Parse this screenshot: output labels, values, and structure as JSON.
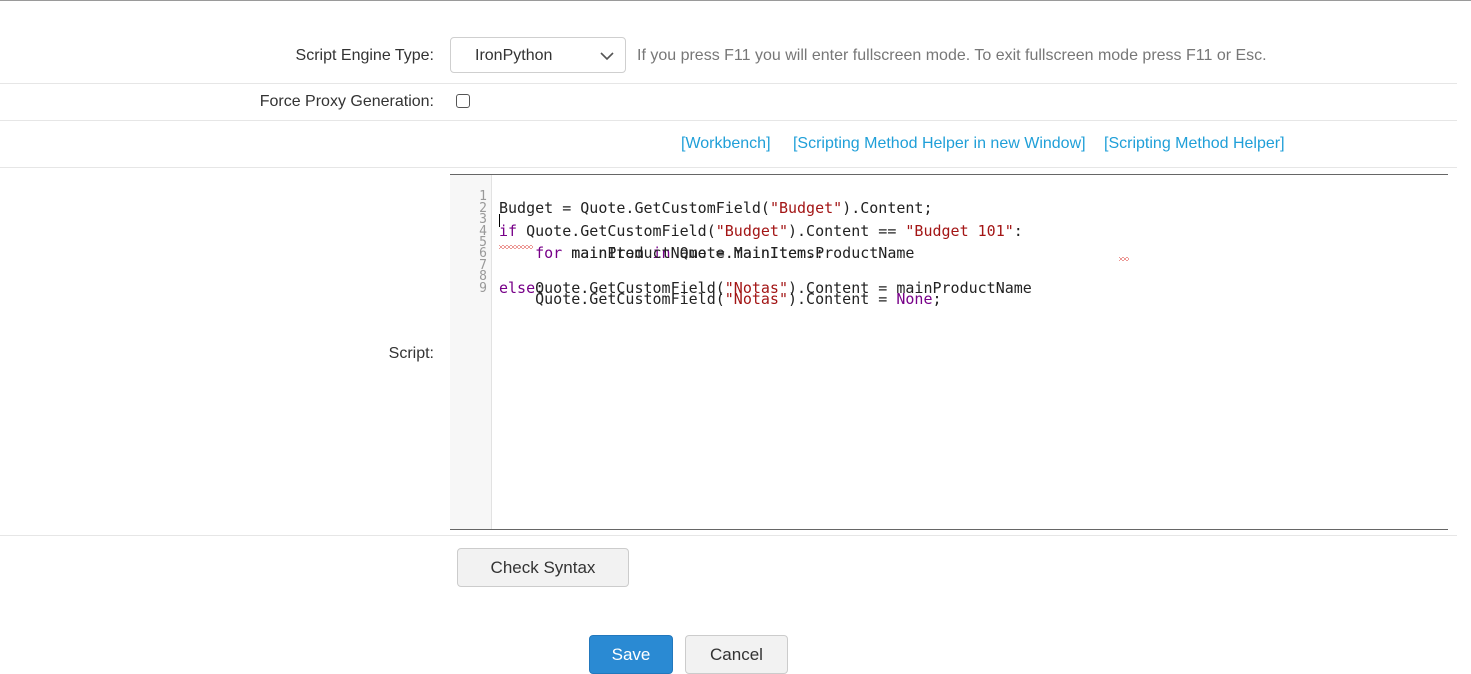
{
  "form": {
    "engine_label": "Script Engine Type:",
    "engine_value": "IronPython",
    "engine_hint": "If you press F11 you will enter fullscreen mode. To exit fullscreen mode press F11 or Esc.",
    "proxy_label": "Force Proxy Generation:",
    "proxy_checked": false,
    "script_label": "Script:"
  },
  "links": [
    "[Workbench]",
    "[Scripting Method Helper in new Window]",
    "[Scripting Method Helper]"
  ],
  "editor": {
    "line_numbers": [
      "1",
      "2",
      "3",
      "4",
      "5",
      "6",
      "7",
      "8",
      "9"
    ],
    "lines": [
      "Budget = Quote.GetCustomField(\"Budget\").Content;",
      "",
      "if Quote.GetCustomField(\"Budget\").Content == \"Budget 101\":",
      "    for mainItem in Quote.MainItems:",
      "        mainProductName = mainItem.ProductName",
      "",
      "    Quote.GetCustomField(\"Notas\").Content = mainProductName",
      "else:",
      "    Quote.GetCustomField(\"Notas\").Content = None;"
    ]
  },
  "buttons": {
    "check_syntax": "Check Syntax",
    "save": "Save",
    "cancel": "Cancel"
  },
  "colors": {
    "link": "#1f9fd8",
    "primary": "#2a8ad3",
    "string": "#a31515",
    "keyword": "#770088",
    "error": "#d9312b"
  },
  "icons": {
    "select_chevron": "chevron-down-icon"
  }
}
